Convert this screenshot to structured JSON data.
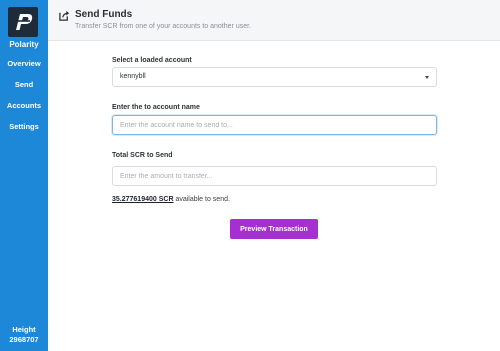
{
  "sidebar": {
    "brand": "Polarity",
    "items": [
      {
        "label": "Overview"
      },
      {
        "label": "Send"
      },
      {
        "label": "Accounts"
      },
      {
        "label": "Settings"
      }
    ],
    "height_label": "Height",
    "height_value": "2968707",
    "color": "#1e88d8"
  },
  "header": {
    "title": "Send Funds",
    "subtitle": "Transfer SCR from one of your accounts to another user.",
    "icon": "share-icon"
  },
  "form": {
    "account_label": "Select a loaded account",
    "account_selected": "kennybll",
    "to_label": "Enter the to account name",
    "to_placeholder": "Enter the account name to send to...",
    "amount_label": "Total SCR to Send",
    "amount_placeholder": "Enter the amount to transfer...",
    "balance_amount": "35.277619400 SCR",
    "balance_suffix": " available to send.",
    "preview_button": "Preview Transaction",
    "button_color": "#a52fd0"
  }
}
